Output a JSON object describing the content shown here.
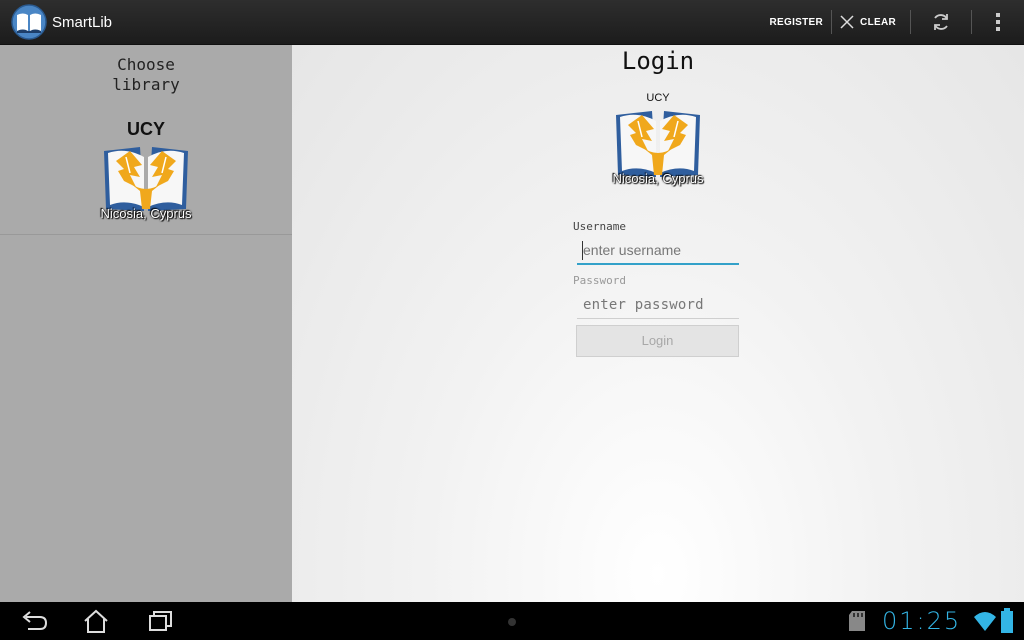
{
  "app": {
    "title": "SmartLib",
    "icon": "book-icon"
  },
  "actionbar": {
    "register_label": "REGISTER",
    "clear_label": "CLEAR",
    "clear_icon": "close-icon",
    "refresh_icon": "refresh-icon",
    "overflow_icon": "overflow-menu-icon"
  },
  "sidebar": {
    "heading": "Choose\nlibrary",
    "items": [
      {
        "name": "UCY",
        "location": "Nicosia, Cyprus"
      }
    ]
  },
  "login": {
    "title": "Login",
    "library_name": "UCY",
    "library_location": "Nicosia, Cyprus",
    "username_label": "Username",
    "username_placeholder": "enter username",
    "password_label": "Password",
    "password_placeholder": "enter password",
    "button_label": "Login"
  },
  "statusbar": {
    "clock": "01:25",
    "icons": [
      "back-icon",
      "home-icon",
      "recent-apps-icon",
      "sd-card-icon",
      "wifi-icon",
      "battery-icon"
    ]
  },
  "colors": {
    "accent": "#33b5e5",
    "focus_underline": "#33a1c9",
    "logo_gold": "#f0a81c",
    "logo_blue": "#2f5e9e"
  }
}
